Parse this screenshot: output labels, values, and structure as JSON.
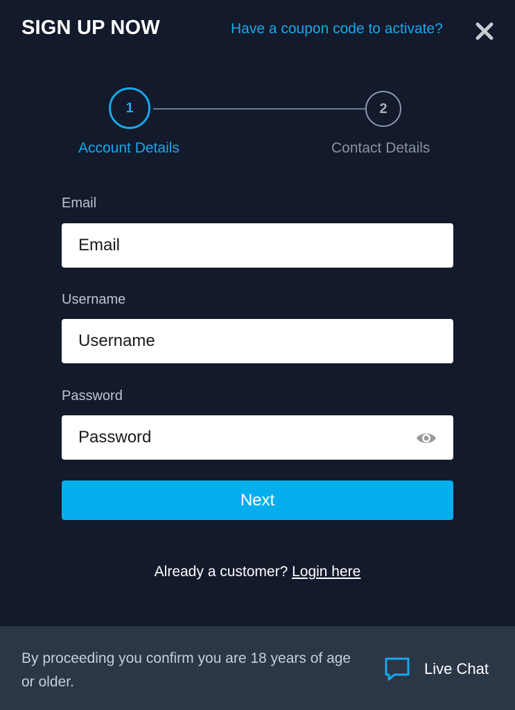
{
  "header": {
    "title": "SIGN UP NOW",
    "coupon_link": "Have a coupon code to activate?"
  },
  "stepper": {
    "steps": [
      {
        "number": "1",
        "label": "Account Details",
        "state": "active"
      },
      {
        "number": "2",
        "label": "Contact Details",
        "state": "inactive"
      }
    ]
  },
  "form": {
    "email": {
      "label": "Email",
      "placeholder": "Email",
      "value": ""
    },
    "username": {
      "label": "Username",
      "placeholder": "Username",
      "value": ""
    },
    "password": {
      "label": "Password",
      "placeholder": "Password",
      "value": ""
    },
    "next_label": "Next"
  },
  "login": {
    "prompt": "Already a customer?",
    "link": "Login here"
  },
  "footer": {
    "disclaimer": "By proceeding you confirm you are 18 years of age or older.",
    "chat_label": "Live Chat"
  },
  "colors": {
    "background": "#121a2b",
    "accent": "#19a9ec",
    "button": "#07aeee",
    "footer": "#2b3647"
  },
  "icons": {
    "close": "close-icon",
    "eye": "eye-icon",
    "chat": "chat-bubble-icon"
  }
}
